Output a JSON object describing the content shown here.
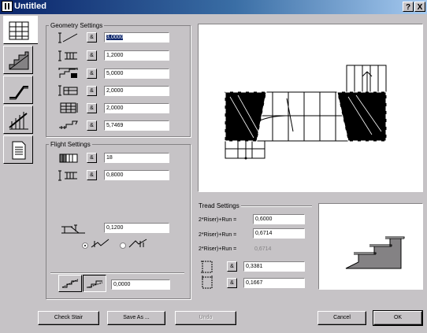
{
  "window": {
    "title": "Untitled",
    "help_label": "?",
    "close_label": "X"
  },
  "tabs": [
    {
      "name": "geometry-tab",
      "active": true
    },
    {
      "name": "structure-tab",
      "active": false
    },
    {
      "name": "stringer-tab",
      "active": false
    },
    {
      "name": "railing-tab",
      "active": false
    },
    {
      "name": "listing-tab",
      "active": false
    }
  ],
  "geometry": {
    "label": "Geometry Settings",
    "rows": [
      {
        "icon": "stair-height-icon",
        "value": "3,0000",
        "selected": true
      },
      {
        "icon": "stair-width-icon",
        "value": "1,2000"
      },
      {
        "icon": "stair-length-icon",
        "value": "5,0000"
      },
      {
        "icon": "landing-length-icon",
        "value": "2,0000"
      },
      {
        "icon": "landing-width-icon",
        "value": "2,0000"
      },
      {
        "icon": "walking-line-icon",
        "value": "5,7469"
      }
    ]
  },
  "flight": {
    "label": "Flight Settings",
    "rows": [
      {
        "icon": "riser-count-icon",
        "value": "18"
      },
      {
        "icon": "flight-width-icon",
        "value": "0,8000"
      }
    ],
    "offset_value": "0,1200",
    "bottom_value": "0,0000"
  },
  "tread": {
    "label": "Tread Settings",
    "rows": [
      {
        "label": "2*Riser)+Run =",
        "value": "0,6000"
      },
      {
        "label": "2*Riser)+Run =",
        "value": "0,6714"
      },
      {
        "label": "2*Riser)+Run =",
        "value": "0,6714",
        "disabled": true
      }
    ],
    "riser_value": "0,3381",
    "tread_value": "0,1667"
  },
  "buttons": {
    "check": "Check Stair",
    "save_as": "Save As ...",
    "undo": "Undo",
    "cancel": "Cancel",
    "ok": "OK"
  },
  "lock_glyph": "&"
}
